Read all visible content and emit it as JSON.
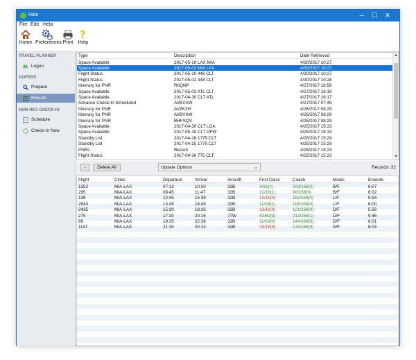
{
  "window": {
    "title": "Halo",
    "minimize": "─",
    "maximize": "☐",
    "close": "✕"
  },
  "menu": [
    "File",
    "Edit",
    "Help"
  ],
  "toolbar": [
    {
      "label": "Home",
      "icon": "home-icon"
    },
    {
      "label": "Preferences",
      "icon": "gears-icon"
    },
    {
      "label": "Print",
      "icon": "printer-icon"
    },
    {
      "label": "Help",
      "icon": "question-icon"
    }
  ],
  "sidebar": {
    "travel_planner": "TRAVEL PLANNER",
    "logon": "Logon",
    "gofers": "GOFERS",
    "prepare": "Prepare",
    "results": "Results",
    "nonrev": "NON-REV CHECK-IN",
    "schedule": "Schedule",
    "checkin_now": "Check-In Now"
  },
  "requests": {
    "headers": [
      "Type",
      "Description",
      "Date Retrieved"
    ],
    "selected_index": 1,
    "rows": [
      [
        "Space Available",
        "2017-05-10 LAX MIA",
        "4/30/2017 10:27"
      ],
      [
        "Space Available",
        "2017-05-03 MIA LAX",
        "4/30/2017 10:27"
      ],
      [
        "Flight Status",
        "2017-05-10 448 CLT",
        "4/30/2017 10:27"
      ],
      [
        "Flight Status",
        "2017-05-02 448 CLT",
        "4/30/2017 10:26"
      ],
      [
        "Itinerary for PNR",
        "RIIQNP",
        "4/27/2017 16:58"
      ],
      [
        "Space Available",
        "2017-05-03 ATL CLT",
        "4/27/2017 16:19"
      ],
      [
        "Space Available",
        "2017-04-30 CLT ATL",
        "4/27/2017 16:17"
      ],
      [
        "Advance Check-In Scheduled",
        "AVBVXW",
        "4/27/2017 07:49"
      ],
      [
        "Itinerary for PNR",
        "AVZKZH",
        "4/26/2017 08:29"
      ],
      [
        "Itinerary for PNR",
        "AVBVXW",
        "4/26/2017 08:29"
      ],
      [
        "Itinerary for PNR",
        "BHFSQV",
        "4/26/2017 08:29"
      ],
      [
        "Space Available",
        "2017-04-30 CLT LGA",
        "4/25/2017 15:33"
      ],
      [
        "Space Available",
        "2017-05-10 CLT DFW",
        "4/25/2017 15:33"
      ],
      [
        "Standby List",
        "2017-04-26 1775 CLT",
        "4/25/2017 15:29"
      ],
      [
        "Standby List",
        "2017-04-25 1775 CLT",
        "4/25/2017 15:29"
      ],
      [
        "PNRs",
        "Recent",
        "4/25/2017 15:23"
      ],
      [
        "Flight Status",
        "2017-04-30 775 CLT",
        "4/25/2017 15:23"
      ]
    ]
  },
  "actions": {
    "minus": "-",
    "delete_all": "Delete All",
    "update_options": "Update Options",
    "records": "Records: 32"
  },
  "flights": {
    "headers": [
      "Flight",
      "Cities",
      "Departure",
      "Arrival",
      "Aircraft",
      "First Class",
      "Coach",
      "Meals",
      "Enroute"
    ],
    "rows": [
      [
        "1352",
        "MIA-LAX",
        "07:13",
        "10:20",
        "32B",
        "3/16(2)",
        "102/168(2)",
        "B/F",
        "6:07"
      ],
      [
        "295",
        "MIA-LAX",
        "08:45",
        "11:47",
        "32B",
        "12/16(1)",
        "90/168(0)",
        "B/F",
        "6:02"
      ],
      [
        "139",
        "MIA-LAX",
        "12:45",
        "15:39",
        "32B",
        "14/16(0)",
        "115/168(0)",
        "L/F",
        "5:54"
      ],
      [
        "2543",
        "MIA-LAX",
        "13:45",
        "16:45",
        "32B",
        "11/16(1)",
        "116/168(0)",
        "L/F",
        "6:00"
      ],
      [
        "2435",
        "MIA-LAX",
        "15:30",
        "18:26",
        "32B",
        "13/16(0)",
        "121/168(0)",
        "D/F",
        "5:56"
      ],
      [
        "275",
        "MIA-LAX",
        "17:30",
        "20:16",
        "77W",
        "43/60(3)",
        "213/255(1)",
        "D/F",
        "5:46"
      ],
      [
        "69",
        "MIA-LAX",
        "19:35",
        "22:36",
        "32B",
        "11/16(0)",
        "144/168(0)",
        "D/F",
        "6:01"
      ],
      [
        "1147",
        "MIA-LAX",
        "21:30",
        "00:33",
        "32B",
        "15/16(5)",
        "133/168(0)",
        "S/F",
        "6:03"
      ]
    ],
    "first_class_colors": [
      "green",
      "green",
      "red",
      "green",
      "red",
      "green",
      "green",
      "red"
    ],
    "coach_colors": [
      "green",
      "green",
      "green",
      "green",
      "green",
      "green",
      "green",
      "green"
    ]
  },
  "colors": {
    "accent": "#1b78d0",
    "selection": "#1a73d4",
    "sidebar_active": "#7d98c0",
    "green": "#3d8b2a",
    "red": "#d2472d"
  }
}
